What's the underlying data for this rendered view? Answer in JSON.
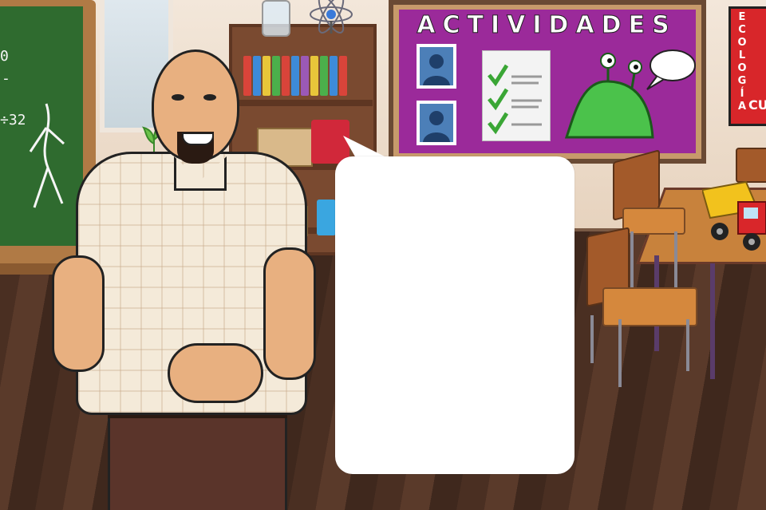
{
  "bulletin_board": {
    "title": "ACTIVIDADES"
  },
  "poster": {
    "letters": [
      "E",
      "C",
      "O",
      "L",
      "O",
      "G",
      "Í",
      "A"
    ],
    "corner_text": "CU"
  },
  "chalkboard": {
    "lines": [
      "0",
      "-",
      "÷32"
    ]
  },
  "speech_bubble": {
    "text": ""
  },
  "colors": {
    "board_purple": "#9b2a9a",
    "chalk_green": "#2f6b2f",
    "poster_red": "#d8262a",
    "checkmark_green": "#3aa635",
    "bubble_white": "#ffffff"
  },
  "icons": [
    "person-photo-icon",
    "checklist-document-icon",
    "green-slug-character-icon",
    "thought-bubble-icon",
    "atom-model-icon",
    "toy-truck-icon"
  ]
}
